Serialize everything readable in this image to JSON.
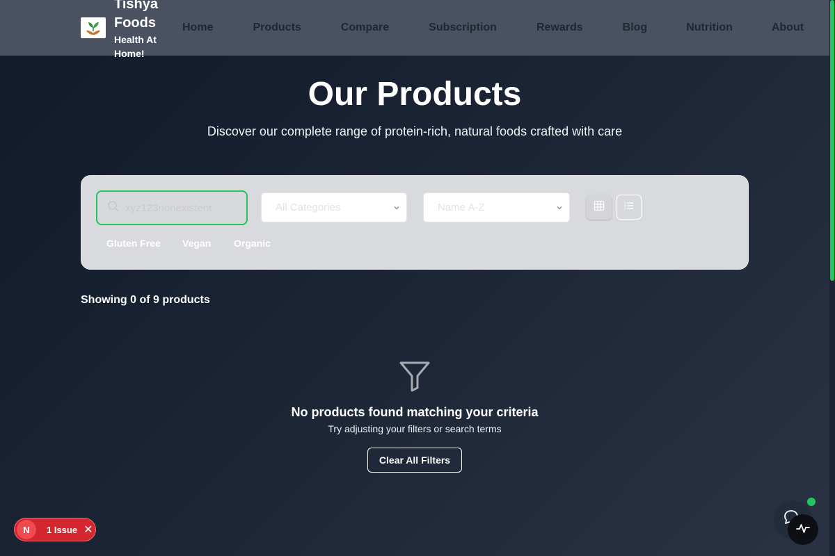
{
  "brand": {
    "name": "Tishya Foods",
    "tagline": "Health At Home!",
    "logo_icon": "sprout-hands-icon"
  },
  "nav": {
    "items": [
      {
        "label": "Home"
      },
      {
        "label": "Products"
      },
      {
        "label": "Compare"
      },
      {
        "label": "Subscription"
      },
      {
        "label": "Rewards"
      },
      {
        "label": "Blog"
      },
      {
        "label": "Nutrition"
      },
      {
        "label": "About"
      }
    ]
  },
  "hero": {
    "title": "Our Products",
    "subtitle": "Discover our complete range of protein-rich, natural foods crafted with care"
  },
  "filters": {
    "search_value": "xyz123nonexistent",
    "category_value": "All Categories",
    "sort_value": "Name A-Z",
    "chips": [
      {
        "label": "Gluten Free"
      },
      {
        "label": "Vegan"
      },
      {
        "label": "Organic"
      }
    ]
  },
  "results": {
    "count_text": "Showing 0 of 9 products",
    "empty_title": "No products found matching your criteria",
    "empty_subtitle": "Try adjusting your filters or search terms",
    "clear_label": "Clear All Filters"
  },
  "dev_overlay": {
    "avatar_letter": "N",
    "issue_label": "1 Issue",
    "close_glyph": "✕"
  },
  "colors": {
    "accent": "#22c55e",
    "header_bg": "#4a5262",
    "page_bg": "#1b2434",
    "issue_red": "#d4262e"
  }
}
